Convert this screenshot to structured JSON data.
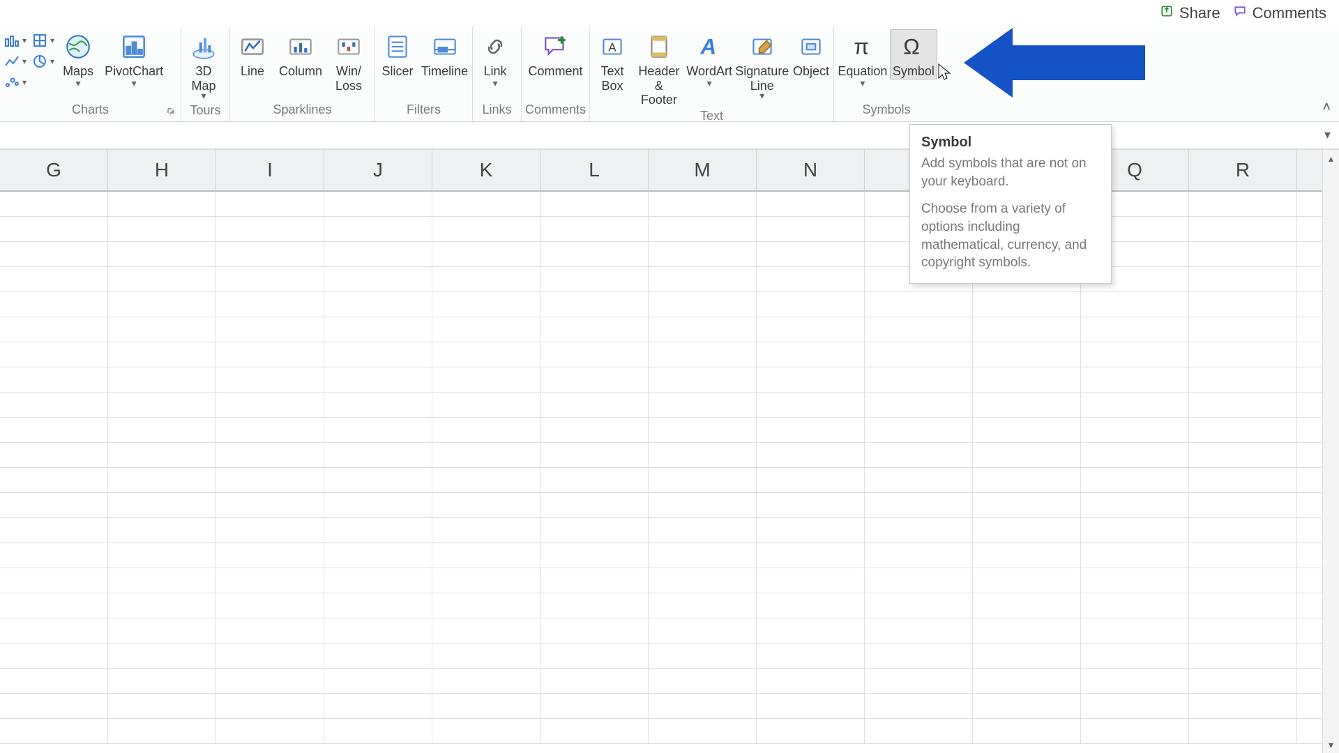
{
  "titlebar": {
    "share": "Share",
    "comments": "Comments"
  },
  "ribbon": {
    "groups": {
      "charts": {
        "label": "Charts"
      },
      "tours": {
        "label": "Tours"
      },
      "sparklines": {
        "label": "Sparklines"
      },
      "filters": {
        "label": "Filters"
      },
      "links": {
        "label": "Links"
      },
      "commentsG": {
        "label": "Comments"
      },
      "text": {
        "label": "Text"
      },
      "symbols": {
        "label": "Symbols"
      }
    },
    "buttons": {
      "maps": "Maps",
      "pivotchart": "PivotChart",
      "map3d": "3D\nMap",
      "line": "Line",
      "column": "Column",
      "winloss": "Win/\nLoss",
      "slicer": "Slicer",
      "timeline": "Timeline",
      "link": "Link",
      "comment": "Comment",
      "textbox": "Text\nBox",
      "headerfooter": "Header\n& Footer",
      "wordart": "WordArt",
      "sigline": "Signature\nLine",
      "object": "Object",
      "equation": "Equation",
      "symbol": "Symbol"
    }
  },
  "tooltip": {
    "title": "Symbol",
    "p1": "Add symbols that are not on your keyboard.",
    "p2": "Choose from a variety of options including mathematical, currency, and copyright symbols."
  },
  "columns": [
    "G",
    "H",
    "I",
    "J",
    "K",
    "L",
    "M",
    "N",
    "",
    "",
    "Q",
    "R"
  ],
  "row_count": 22
}
